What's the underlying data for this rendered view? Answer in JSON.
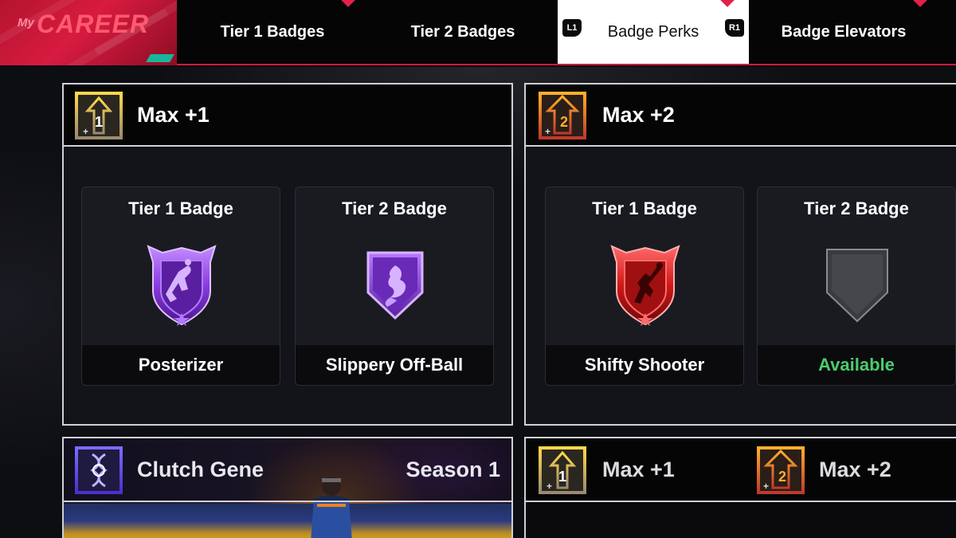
{
  "nav": {
    "logo_prefix": "My",
    "logo_text": "CAREER",
    "tabs": [
      {
        "label": "Tier 1 Badges"
      },
      {
        "label": "Tier 2 Badges"
      },
      {
        "label": "Badge Perks",
        "active": true
      },
      {
        "label": "Badge Elevators"
      }
    ],
    "left_trigger": "L1",
    "right_trigger": "R1"
  },
  "perks": [
    {
      "title": "Max +1",
      "icon": "max-plus-1-icon",
      "slots": [
        {
          "heading": "Tier 1 Badge",
          "name": "Posterizer",
          "tier_color": "purple",
          "icon": "posterizer-badge-icon"
        },
        {
          "heading": "Tier 2 Badge",
          "name": "Slippery Off-Ball",
          "tier_color": "purple",
          "icon": "slippery-off-ball-badge-icon"
        }
      ]
    },
    {
      "title": "Max +2",
      "icon": "max-plus-2-icon",
      "slots": [
        {
          "heading": "Tier 1 Badge",
          "name": "Shifty Shooter",
          "tier_color": "red",
          "icon": "shifty-shooter-badge-icon"
        },
        {
          "heading": "Tier 2 Badge",
          "name": "Available",
          "tier_color": "gray",
          "icon": "empty-badge-slot-icon"
        }
      ]
    }
  ],
  "bottom_left": {
    "title": "Clutch Gene",
    "tag": "Season 1",
    "icon": "clutch-gene-icon"
  },
  "bottom_right": {
    "items": [
      {
        "title": "Max +1",
        "icon": "max-plus-1-icon"
      },
      {
        "title": "Max +2",
        "icon": "max-plus-2-icon"
      }
    ]
  },
  "colors": {
    "accent_red": "#d11a3c",
    "available_green": "#4ccb6e",
    "badge_purple": "#8a3ce0",
    "badge_red": "#d01818"
  }
}
